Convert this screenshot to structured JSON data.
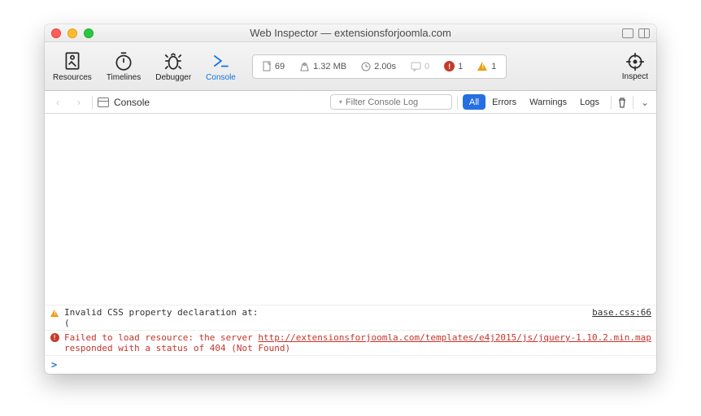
{
  "title": "Web Inspector — extensionsforjoomla.com",
  "tabs": {
    "resources": "Resources",
    "timelines": "Timelines",
    "debugger": "Debugger",
    "console": "Console",
    "inspect": "Inspect"
  },
  "stats": {
    "docs": "69",
    "size": "1.32 MB",
    "time": "2.00s",
    "chats": "0",
    "errors": "1",
    "warnings": "1"
  },
  "breadcrumb": "Console",
  "filter_placeholder": "Filter Console Log",
  "filters": {
    "all": "All",
    "errors": "Errors",
    "warnings": "Warnings",
    "logs": "Logs"
  },
  "log": {
    "warn_msg": "Invalid CSS property declaration at: (",
    "warn_src": "base.css:66",
    "err_msg": "Failed to load resource: the server responded with a status of 404 (Not Found)",
    "err_link": "http://extensionsforjoomla.com/templates/e4j2015/js/jquery-1.10.2.min.map"
  },
  "prompt": ">"
}
